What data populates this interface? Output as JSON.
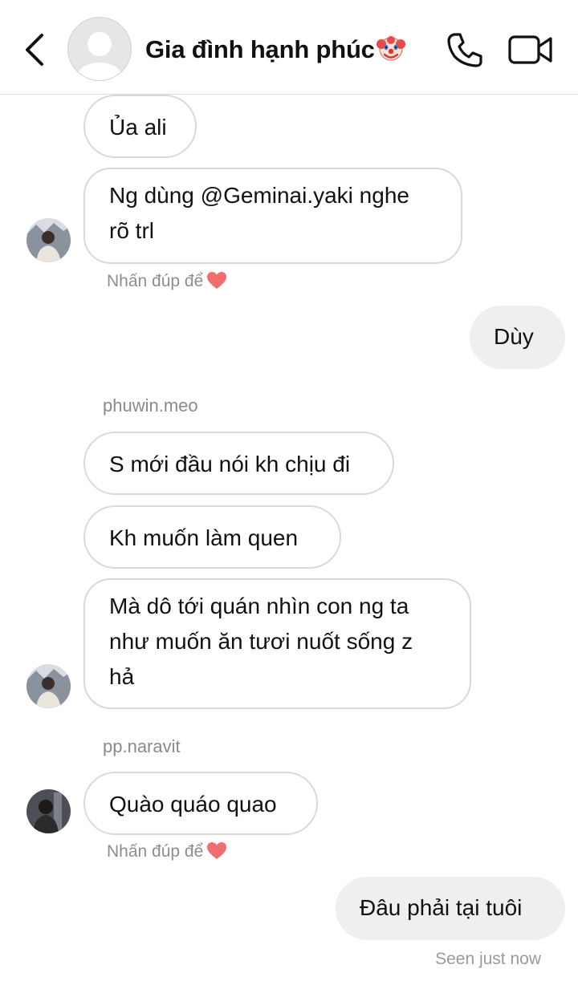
{
  "header": {
    "title": "Gia đình hạnh phúc",
    "title_emoji": "clown-face-emoji",
    "icons": [
      "back-chevron-icon",
      "group-avatar-placeholder",
      "phone-icon",
      "video-call-icon"
    ]
  },
  "messages": {
    "m1": "Ủa ali",
    "m2_line1": "Ng dùng @Geminai.yaki nghe",
    "m2_line2": "rõ trl",
    "hint1": "Nhấn đúp để",
    "m3": "Dùy",
    "sender1": "phuwin.meo",
    "m4": "S mới đầu nói kh chịu đi",
    "m5": "Kh muốn làm quen",
    "m6_line1": "Mà dô tới quán nhìn con ng ta",
    "m6_line2": "như muốn ăn tươi nuốt sống z",
    "m6_line3": "hả",
    "sender2": "pp.naravit",
    "m7": "Quào quáo quao",
    "hint2": "Nhấn đúp để",
    "m8": "Đâu phải tại tuôi",
    "seen": "Seen just now"
  },
  "colors": {
    "incoming_border": "#d9d9d9",
    "outgoing_bg": "#efefef",
    "heart": "#f26d6d",
    "muted_text": "#8e8e8e"
  }
}
